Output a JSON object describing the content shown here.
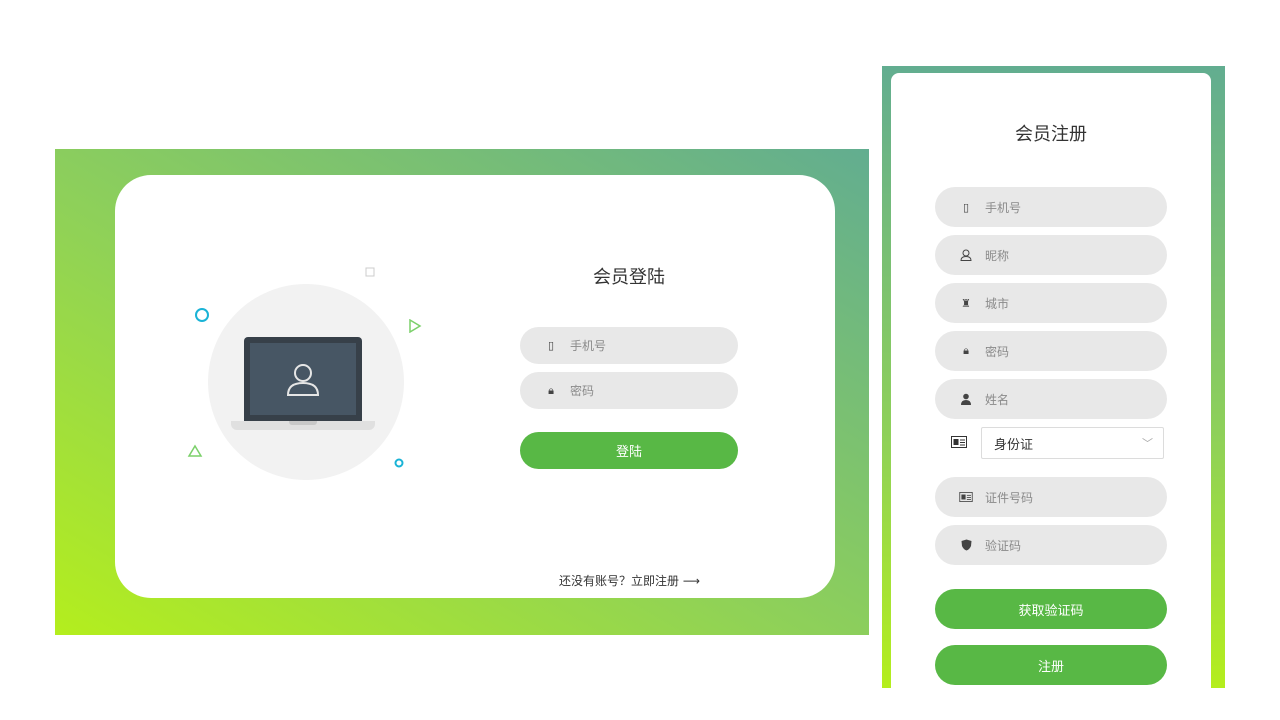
{
  "login": {
    "title": "会员登陆",
    "phone_placeholder": "手机号",
    "password_placeholder": "密码",
    "submit_label": "登陆",
    "register_prompt": "还没有账号？立即注册",
    "register_arrow": "⟶"
  },
  "register": {
    "title": "会员注册",
    "fields": {
      "phone": "手机号",
      "nickname": "昵称",
      "city": "城市",
      "password": "密码",
      "name": "姓名",
      "id_number": "证件号码",
      "code": "验证码"
    },
    "id_type_selected": "身份证",
    "get_code_label": "获取验证码",
    "submit_label": "注册"
  },
  "colors": {
    "accent_green": "#58b845",
    "gradient_start": "#b4ee1d",
    "gradient_end": "#62ad90",
    "input_bg": "#e8e8e8"
  },
  "icons": {
    "phone": "phone-icon",
    "lock": "lock-icon",
    "user": "user-outline-icon",
    "city": "city-icon",
    "person": "person-icon",
    "id_card": "id-card-icon",
    "shield": "shield-icon"
  }
}
